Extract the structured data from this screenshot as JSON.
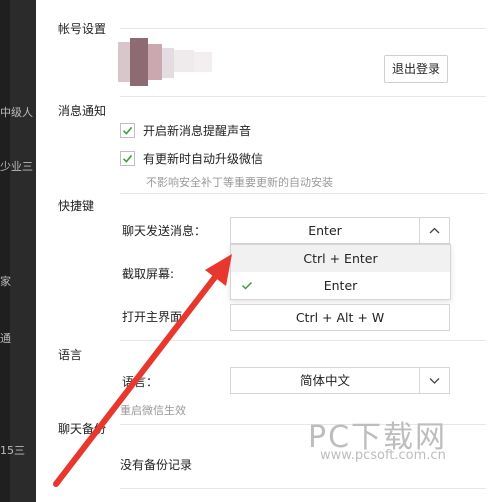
{
  "left_sidebar": {
    "fragments": [
      "中级人",
      "少业三",
      "家",
      "通",
      "15三"
    ]
  },
  "account": {
    "section_title": "帐号设置",
    "logout_button": "退出登录"
  },
  "notifications": {
    "section_title": "消息通知",
    "opt1": "开启新消息提醒声音",
    "opt2": "有更新时自动升级微信",
    "opt2_hint": "不影响安全补丁等重要更新的自动安装"
  },
  "shortcuts": {
    "section_title": "快捷键",
    "send_label": "聊天发送消息：",
    "send_value": "Enter",
    "options": [
      "Ctrl + Enter",
      "Enter"
    ],
    "screenshot_label": "截取屏幕:",
    "open_main_label": "打开主界面:",
    "open_main_value": "Ctrl + Alt + W"
  },
  "language": {
    "section_title": "语言",
    "label": "语言：",
    "value": "简体中文",
    "restart_hint": "重启微信生效"
  },
  "backup": {
    "section_title": "聊天备份",
    "no_backup": "没有备份记录"
  },
  "watermark": {
    "line1": "PC下载网",
    "line2": "www.pcsoft.com.cn"
  },
  "colors": {
    "checkmark": "#3a9e3a",
    "arrow": "#e8382d"
  }
}
